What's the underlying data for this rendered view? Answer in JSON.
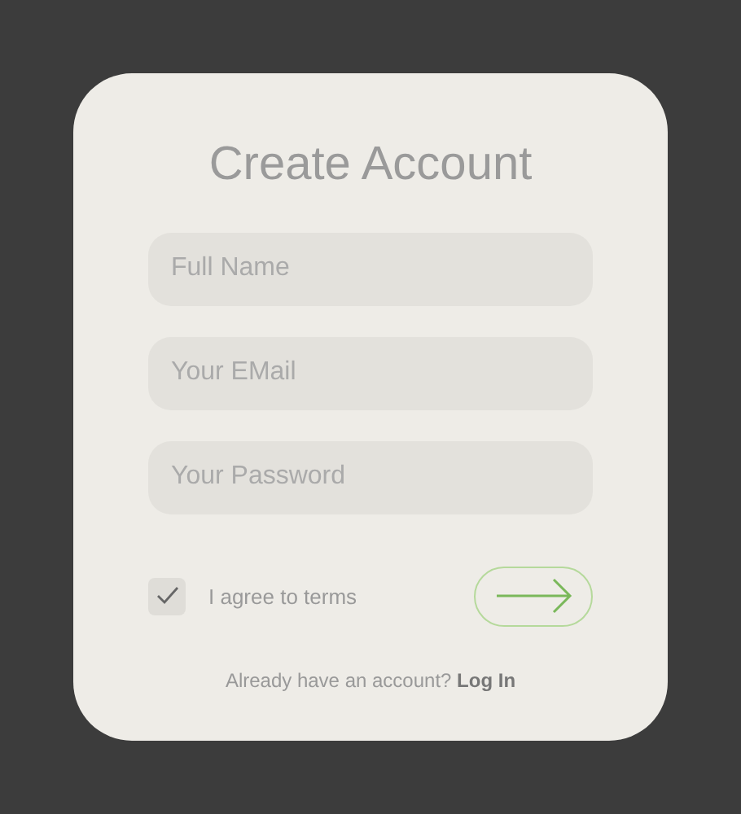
{
  "title": "Create Account",
  "fields": [
    {
      "placeholder": "Full Name"
    },
    {
      "placeholder": "Your EMail"
    },
    {
      "placeholder": "Your Password"
    }
  ],
  "terms": {
    "label": "I agree to terms",
    "checked": true
  },
  "footer": {
    "text": "Already have an account?",
    "link": "Log In"
  }
}
